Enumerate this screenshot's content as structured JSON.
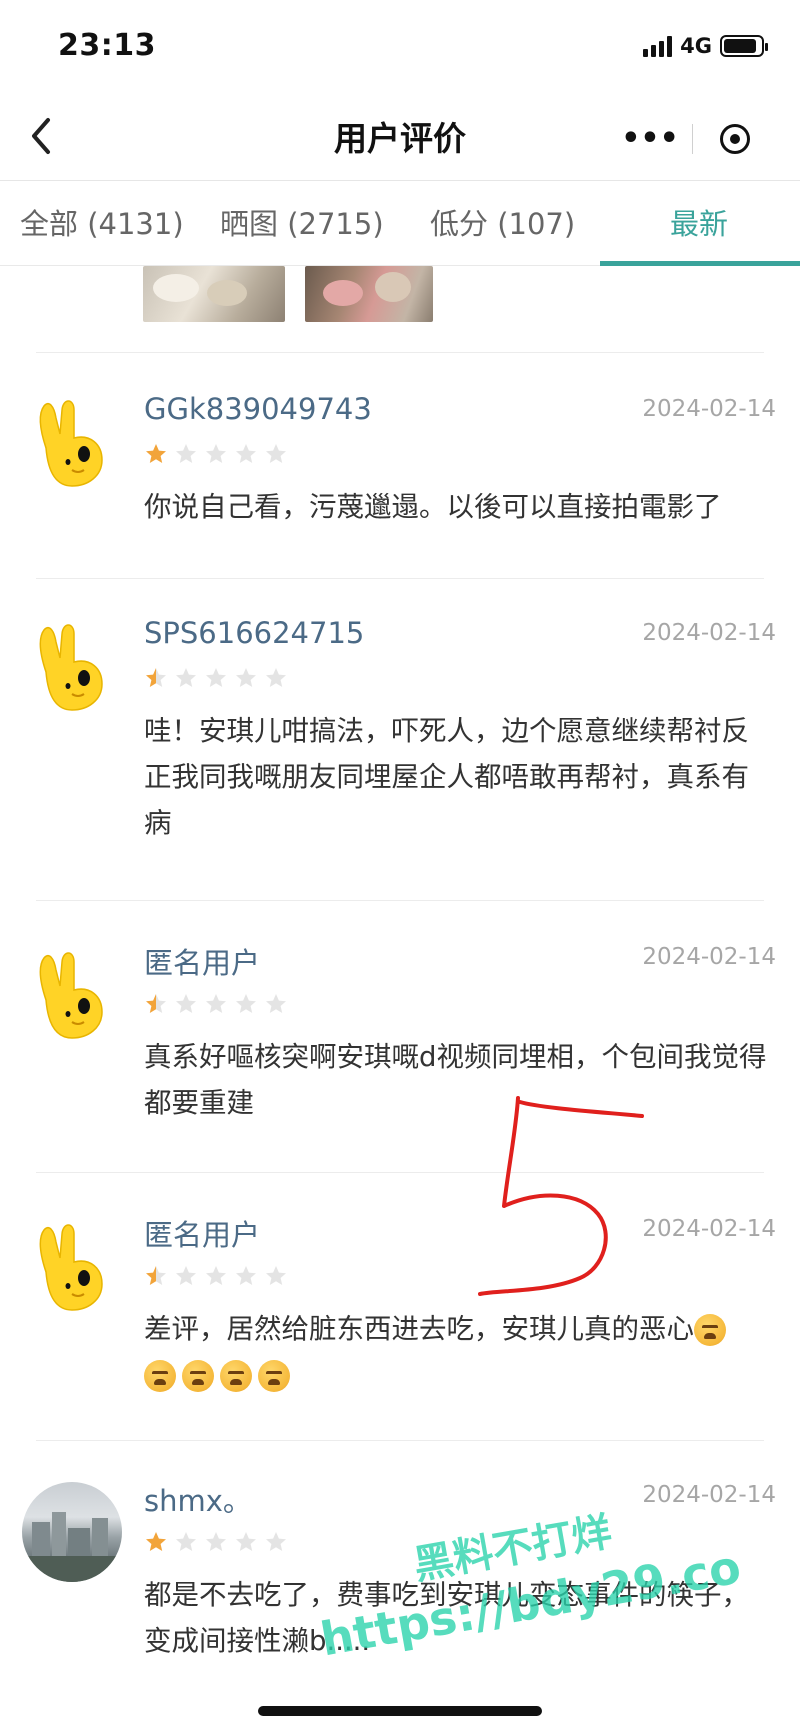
{
  "status_bar": {
    "time": "23:13",
    "network": "4G",
    "battery_level": 0.9
  },
  "nav": {
    "title": "用户评价",
    "more_icon": "more-dots-icon",
    "close_icon": "target-icon",
    "back_icon": "chevron-left-icon"
  },
  "tabs": [
    {
      "label": "全部 (4131)"
    },
    {
      "label": "晒图 (2715)"
    },
    {
      "label": "低分 (107)"
    },
    {
      "label": "最新"
    }
  ],
  "active_tab": "最新",
  "accent_color": "#3aa39b",
  "username_color": "#4b6a86",
  "star_color": "#f2a43a",
  "reviews": [
    {
      "username": "GGk839049743",
      "date": "2024-02-14",
      "rating": 1,
      "text": "你说自己看，污蔑邋遢。以後可以直接拍電影了",
      "avatar": "yellow-hand-avatar"
    },
    {
      "username": "SPS616624715",
      "date": "2024-02-14",
      "rating": 0.5,
      "text": "哇！安琪儿咁搞法，吓死人，边个愿意继续帮衬反正我同我嘅朋友同埋屋企人都唔敢再帮衬，真系有病",
      "avatar": "yellow-hand-avatar"
    },
    {
      "username": "匿名用户",
      "date": "2024-02-14",
      "rating": 0.5,
      "text": "真系好嘔核突啊安琪嘅d视频同埋相，个包间我觉得都要重建",
      "avatar": "yellow-hand-avatar"
    },
    {
      "username": "匿名用户",
      "date": "2024-02-14",
      "rating": 0.5,
      "text": "差评，居然给脏东西进去吃，安琪儿真的恶心",
      "emoji_count": 5,
      "avatar": "yellow-hand-avatar"
    },
    {
      "username": "shmx。",
      "date": "2024-02-14",
      "rating": 1,
      "text": "都是不去吃了，费事吃到安琪儿变态事件的筷子，变成间接性濑b.....",
      "avatar": "photo-avatar"
    }
  ],
  "watermark": {
    "line1": "黑料不打烊",
    "line2": "https://bdy29.co"
  }
}
